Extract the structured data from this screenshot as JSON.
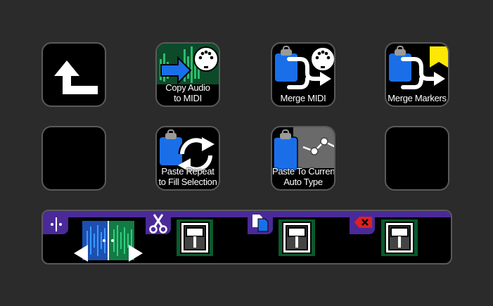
{
  "keys": {
    "copy_audio_to_midi": {
      "line1": "Copy Audio",
      "line2": "to MIDI"
    },
    "merge_midi": {
      "label": "Merge MIDI"
    },
    "merge_markers": {
      "label": "Merge Markers"
    },
    "paste_repeat": {
      "line1": "Paste Repeat",
      "line2": "to Fill Selection"
    },
    "paste_to_current_auto": {
      "line1": "Paste To Current",
      "line2": "Auto Type"
    }
  },
  "colors": {
    "key_bg": "#000000",
    "key_border": "#5a5a5a",
    "accent_blue": "#1a6fe8",
    "accent_purple": "#4a2a98",
    "wave_green": "#1e8f4e",
    "marker_yellow": "#ffe800",
    "delete_red": "#e02020"
  },
  "icons": {
    "back": "return-arrow-icon",
    "midi": "midi-connector-icon",
    "clipboard": "clipboard-icon",
    "merge": "merge-arrow-icon",
    "marker": "marker-flag-icon",
    "repeat": "repeat-arrows-icon",
    "automation": "automation-points-icon",
    "split": "split-icon",
    "cut": "scissors-icon",
    "copy": "copy-icon",
    "delete": "delete-icon",
    "fader": "fader-icon"
  }
}
